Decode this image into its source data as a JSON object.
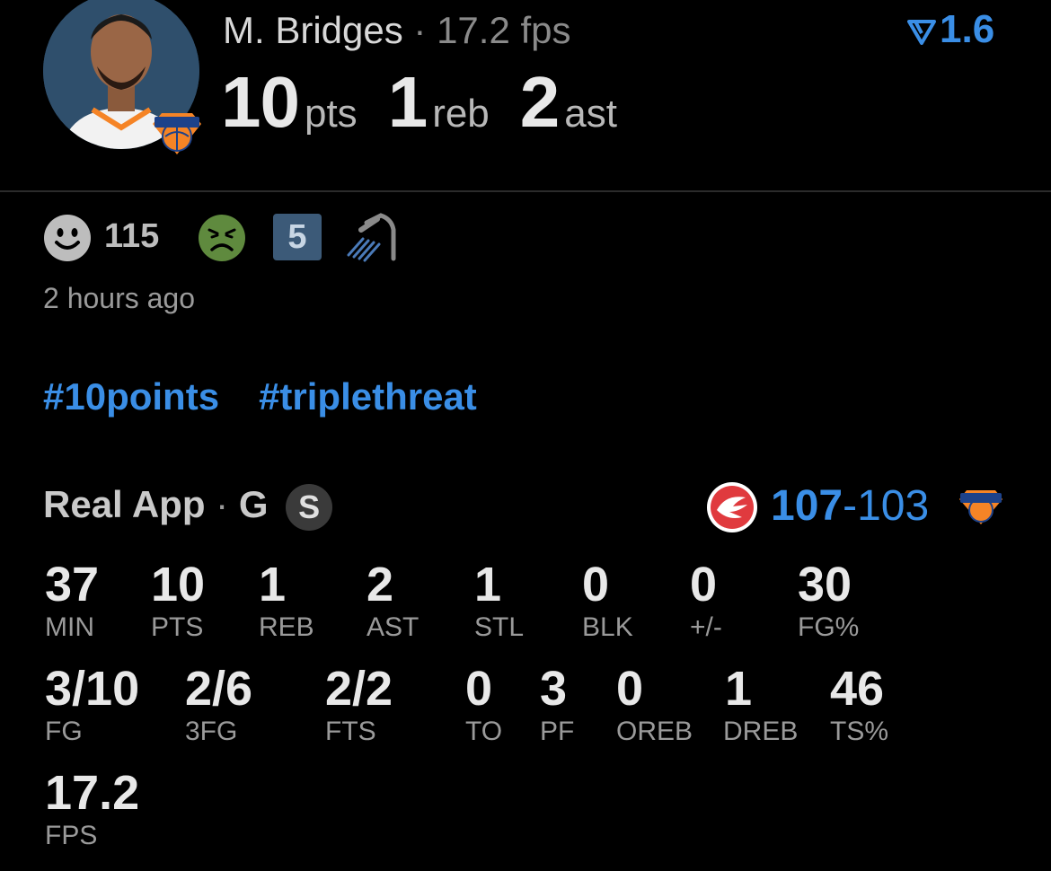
{
  "player": {
    "name": "M. Bridges",
    "separator": "·",
    "fps_label": "17.2 fps"
  },
  "headline_stats": [
    {
      "value": "10",
      "unit": "pts"
    },
    {
      "value": "1",
      "unit": "reb"
    },
    {
      "value": "2",
      "unit": "ast"
    }
  ],
  "trend": {
    "value": "1.6",
    "icon": "trend-down-icon",
    "color": "#3a8ee6"
  },
  "reactions": {
    "happy_count": "115",
    "badge_number": "5",
    "icons": [
      "happy-face-icon",
      "sick-face-icon",
      "shower-icon"
    ]
  },
  "time_ago": "2 hours ago",
  "hashtags": [
    "#10points",
    "#triplethreat"
  ],
  "game": {
    "source": "Real App",
    "separator": "·",
    "position": "G",
    "status_badge": "S",
    "score_left": "107",
    "score_dash": "-",
    "score_right": "103",
    "accent_color": "#3a8ee6"
  },
  "stats_row1": [
    {
      "value": "37",
      "label": "MIN"
    },
    {
      "value": "10",
      "label": "PTS"
    },
    {
      "value": "1",
      "label": "REB"
    },
    {
      "value": "2",
      "label": "AST"
    },
    {
      "value": "1",
      "label": "STL"
    },
    {
      "value": "0",
      "label": "BLK"
    },
    {
      "value": "0",
      "label": "+/-"
    },
    {
      "value": "30",
      "label": "FG%"
    }
  ],
  "stats_row2": [
    {
      "value": "3/10",
      "label": "FG"
    },
    {
      "value": "2/6",
      "label": "3FG"
    },
    {
      "value": "2/2",
      "label": "FTS"
    },
    {
      "value": "0",
      "label": "TO"
    },
    {
      "value": "3",
      "label": "PF"
    },
    {
      "value": "0",
      "label": "OREB"
    },
    {
      "value": "1",
      "label": "DREB"
    },
    {
      "value": "46",
      "label": "TS%"
    }
  ],
  "stats_row3": [
    {
      "value": "17.2",
      "label": "FPS"
    }
  ]
}
